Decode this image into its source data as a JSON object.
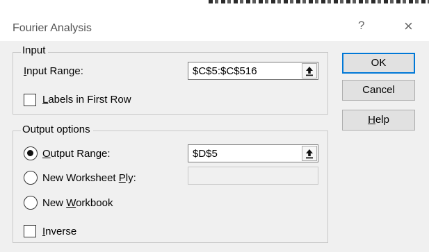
{
  "window": {
    "title": "Fourier Analysis",
    "help_glyph": "?",
    "close_glyph": "×"
  },
  "input_group": {
    "legend": "Input",
    "input_range": {
      "label_pre": "",
      "label_ul": "I",
      "label_post": "nput Range:",
      "value": "$C$5:$C$516",
      "picker_icon": "collapse-dialog-icon"
    },
    "labels_first_row": {
      "label_ul": "L",
      "label_post": "abels in First Row",
      "checked": false
    }
  },
  "output_group": {
    "legend": "Output options",
    "output_range": {
      "label_ul": "O",
      "label_post": "utput Range:",
      "selected": true,
      "value": "$D$5",
      "picker_icon": "collapse-dialog-icon"
    },
    "new_worksheet": {
      "label_pre": "New Worksheet ",
      "label_ul": "P",
      "label_post": "ly:",
      "selected": false,
      "value": ""
    },
    "new_workbook": {
      "label_pre": "New ",
      "label_ul": "W",
      "label_post": "orkbook",
      "selected": false
    },
    "inverse": {
      "label_ul": "I",
      "label_post": "nverse",
      "checked": false
    }
  },
  "buttons": {
    "ok": "OK",
    "cancel": "Cancel",
    "help_ul": "H",
    "help_post": "elp"
  }
}
